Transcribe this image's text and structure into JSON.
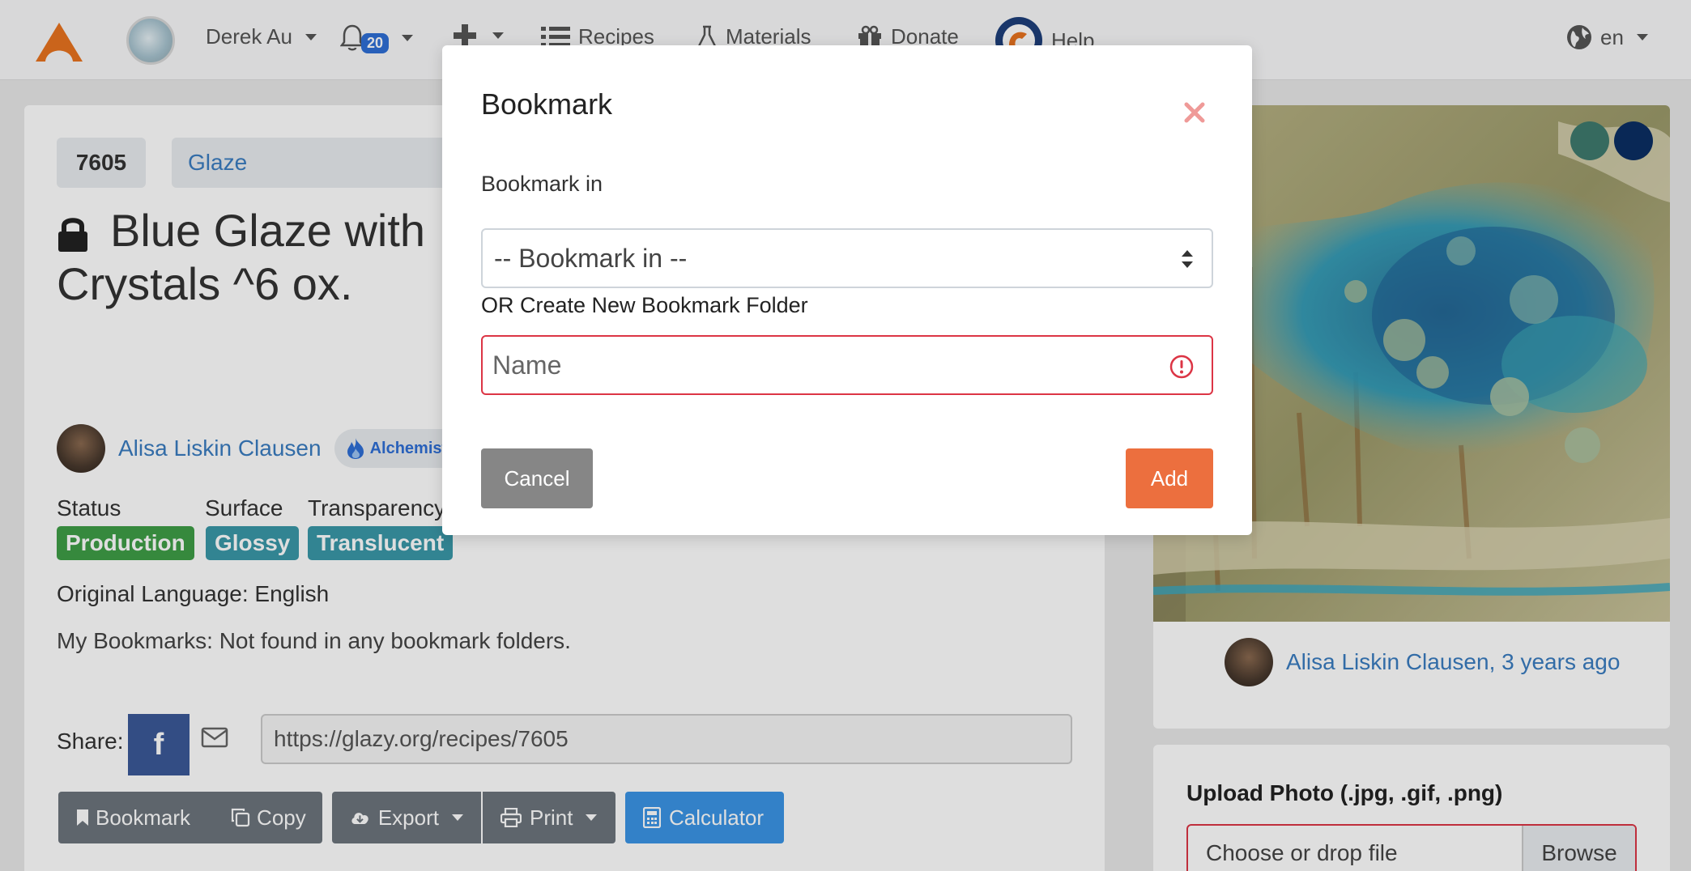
{
  "navbar": {
    "user_name": "Derek Au",
    "notification_count": "20",
    "recipes_label": "Recipes",
    "materials_label": "Materials",
    "donate_label": "Donate",
    "help_label": "Help",
    "language": "en",
    "icons": [
      "glazy-logo-icon",
      "bell-icon",
      "plus-icon",
      "list-icon",
      "flask-icon",
      "gift-icon",
      "help-icon",
      "globe-icon"
    ]
  },
  "recipe": {
    "id": "7605",
    "type": "Glaze",
    "title": "Blue Glaze with Crystals ^6 ox.",
    "author": "Alisa Liskin Clausen",
    "author_badge": "Alchemist",
    "meta_labels": {
      "status": "Status",
      "surface": "Surface",
      "transparency": "Transparency"
    },
    "status": "Production",
    "surface": "Glossy",
    "transparency": "Translucent",
    "original_language": "Original Language: English",
    "bookmarks_status": "My Bookmarks: Not found in any bookmark folders.",
    "share_label": "Share:",
    "facebook_letter": "f",
    "share_url": "https://glazy.org/recipes/7605"
  },
  "actions": {
    "bookmark": "Bookmark",
    "copy": "Copy",
    "export": "Export",
    "print": "Print",
    "calculator": "Calculator"
  },
  "photo": {
    "credit": "Alisa Liskin Clausen, 3 years ago",
    "swatch_colors": [
      "#3f7a6e",
      "#0b2e63"
    ]
  },
  "upload": {
    "title": "Upload Photo (.jpg, .gif, .png)",
    "placeholder": "Choose or drop file",
    "browse": "Browse"
  },
  "modal": {
    "title": "Bookmark",
    "bookmark_in_label": "Bookmark in",
    "select_value": "-- Bookmark in --",
    "create_label": "OR Create New Bookmark Folder",
    "name_placeholder": "Name",
    "cancel": "Cancel",
    "add": "Add"
  },
  "colors": {
    "accent_orange": "#ec6f3e",
    "link_blue": "#3a7cc0",
    "status_green": "#3f9e47",
    "pill_teal": "#3a98a8",
    "error_red": "#dc3545"
  }
}
